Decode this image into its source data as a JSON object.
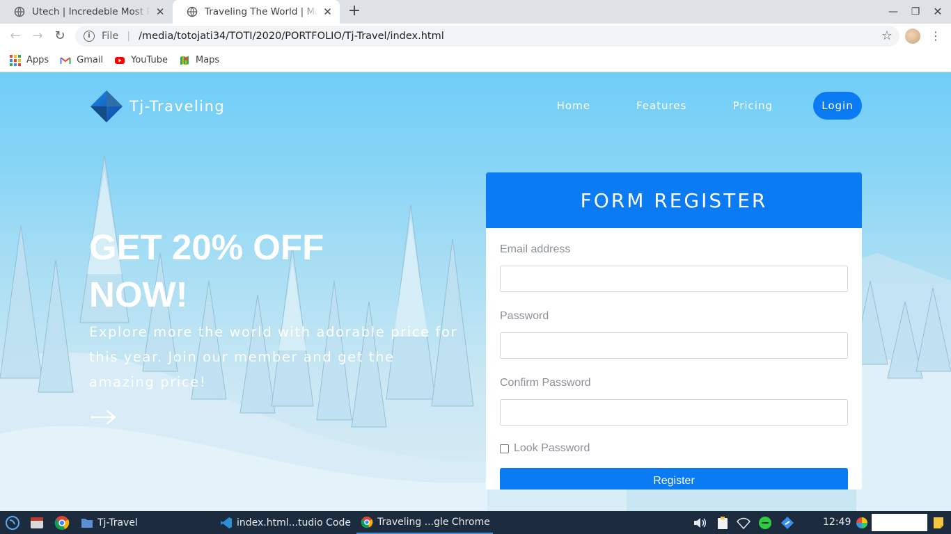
{
  "browser": {
    "tabs": [
      {
        "title": "Utech | Incredeble Most Popular",
        "active": false
      },
      {
        "title": "Traveling The World | Make Your Day",
        "active": true
      }
    ],
    "url_scheme": "File",
    "url": "/media/totojati34/TOTI/2020/PORTFOLIO/Tj-Travel/index.html",
    "bookmarks": [
      {
        "label": "Apps",
        "icon": "apps-grid-icon"
      },
      {
        "label": "Gmail",
        "icon": "gmail-icon"
      },
      {
        "label": "YouTube",
        "icon": "youtube-icon"
      },
      {
        "label": "Maps",
        "icon": "maps-icon"
      }
    ]
  },
  "page": {
    "brand": "Tj-Traveling",
    "nav": {
      "home": "Home",
      "features": "Features",
      "pricing": "Pricing",
      "login": "Login"
    },
    "hero": {
      "title": "GET 20% OFF NOW!",
      "subtitle": "Explore more the world with adorable price for this year. Join our member and get the amazing price!"
    },
    "form": {
      "title": "FORM REGISTER",
      "email_label": "Email address",
      "password_label": "Password",
      "confirm_label": "Confirm Password",
      "show_password_label": "Look Password",
      "show_password_checked": false,
      "submit_label": "Register"
    },
    "colors": {
      "accent": "#0b7bf3",
      "sky": "#6fcdf8"
    }
  },
  "taskbar": {
    "items": [
      {
        "label": "Tj-Travel",
        "icon": "folder-icon"
      },
      {
        "label": "index.html...tudio Code",
        "icon": "vscode-icon"
      },
      {
        "label": "Traveling ...gle Chrome",
        "icon": "chrome-icon",
        "active": true
      }
    ],
    "clock": "12:49"
  }
}
